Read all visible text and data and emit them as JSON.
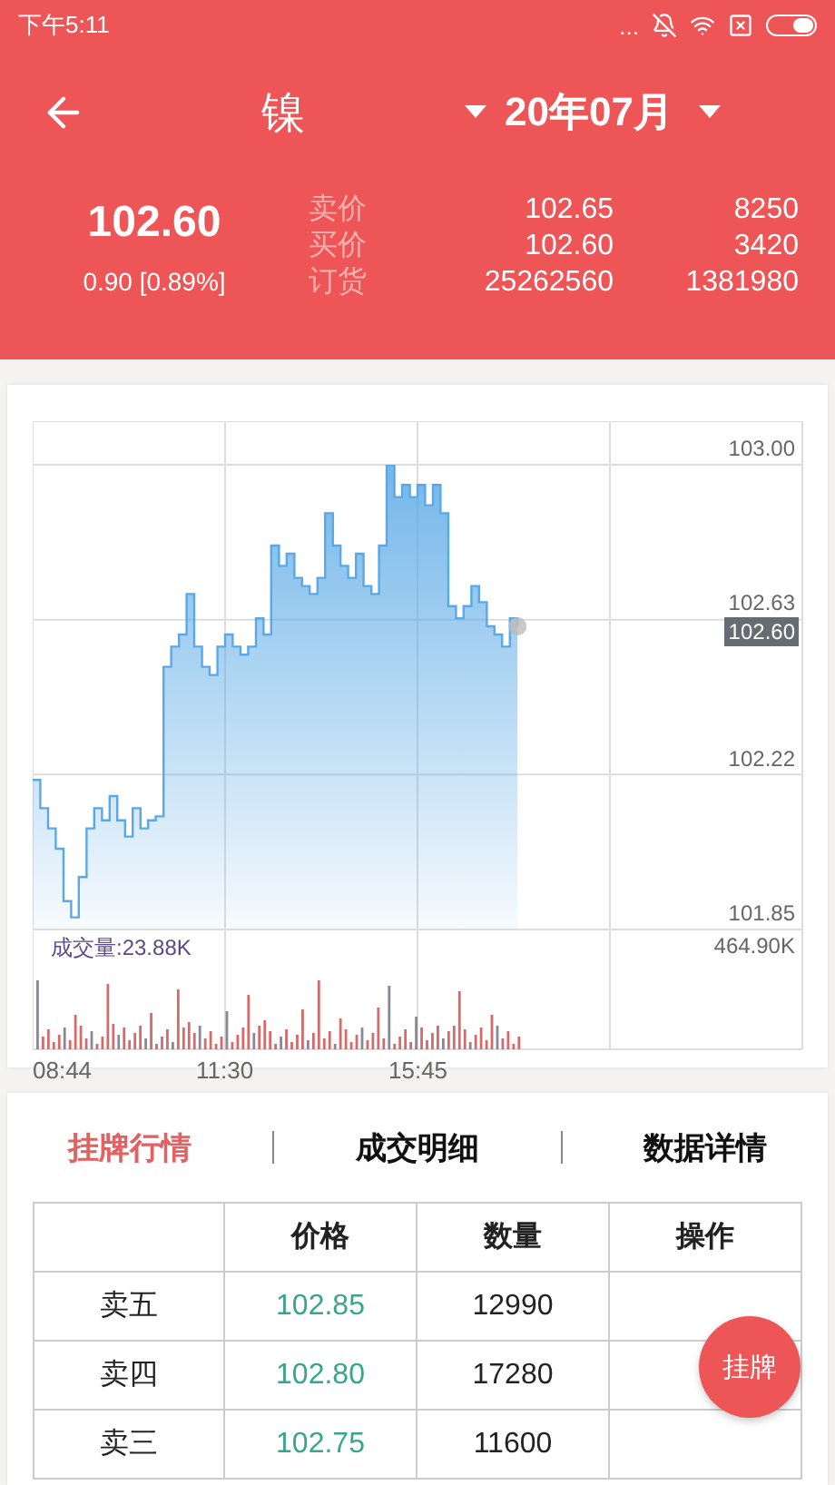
{
  "status_bar": {
    "time": "下午5:11",
    "more": "..."
  },
  "header": {
    "commodity": "镍",
    "contract": "20年07月"
  },
  "quote": {
    "price": "102.60",
    "change": "0.90 [0.89%]",
    "rows": [
      {
        "label": "卖价",
        "price": "102.65",
        "volume": "8250"
      },
      {
        "label": "买价",
        "price": "102.60",
        "volume": "3420"
      },
      {
        "label": "订货",
        "price": "25262560",
        "volume": "1381980"
      }
    ]
  },
  "chart": {
    "last_price": "102.60",
    "volume_label": "成交量:23.88K",
    "volume_max": "464.90K",
    "y_labels": [
      "103.00",
      "102.63",
      "102.22",
      "101.85"
    ],
    "x_labels": [
      "08:44",
      "11:30",
      "15:45"
    ]
  },
  "tabs": [
    {
      "label": "挂牌行情",
      "selected": true
    },
    {
      "label": "成交明细",
      "selected": false
    },
    {
      "label": "数据详情",
      "selected": false
    }
  ],
  "table": {
    "columns": [
      "价格",
      "数量",
      "操作"
    ],
    "rows": [
      {
        "name": "卖五",
        "price": "102.85",
        "quantity": "12990"
      },
      {
        "name": "卖四",
        "price": "102.80",
        "quantity": "17280"
      },
      {
        "name": "卖三",
        "price": "102.75",
        "quantity": "11600"
      }
    ]
  },
  "fab": {
    "label": "挂牌"
  }
}
